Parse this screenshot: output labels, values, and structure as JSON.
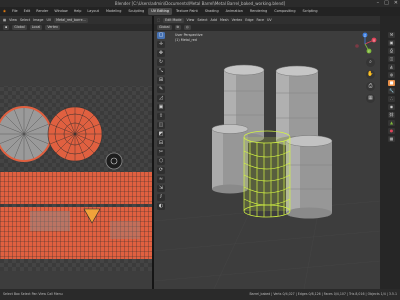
{
  "window": {
    "title": "Blender [C:\\Users\\admin\\Documents\\Metal Barrel\\Metal Barrel_baked_working.blend]"
  },
  "menubar": {
    "items": [
      "File",
      "Edit",
      "Render",
      "Window",
      "Help"
    ],
    "workspaces": [
      "Layout",
      "Modeling",
      "Sculpting",
      "UV Editing",
      "Texture Paint",
      "Shading",
      "Animation",
      "Rendering",
      "Compositing",
      "Scripting"
    ],
    "active_workspace": "UV Editing"
  },
  "uv_editor": {
    "header_items": [
      "View",
      "Select",
      "Image",
      "UV"
    ],
    "image_name": "Metal_red_barre...",
    "header2_items": [
      "Global",
      "Local"
    ],
    "snap": "Vertex"
  },
  "viewport": {
    "header_items": [
      "Edit Mode",
      "View",
      "Select",
      "Add",
      "Mesh",
      "Vertex",
      "Edge",
      "Face",
      "UV"
    ],
    "header2_items": [
      "Global"
    ],
    "view_label": "User Perspective",
    "object_label": "(1) Metal_red",
    "gizmo_axes": [
      "X",
      "Y",
      "Z"
    ]
  },
  "toolbar": {
    "icons": [
      "select-box-icon",
      "cursor-icon",
      "move-icon",
      "rotate-icon",
      "scale-icon",
      "transform-icon",
      "annotate-icon",
      "measure-icon",
      "add-cube-icon",
      "extrude-icon",
      "inset-icon",
      "bevel-icon",
      "loopcut-icon",
      "knife-icon",
      "polybuild-icon",
      "spin-icon",
      "smooth-icon",
      "shrink-icon",
      "shear-icon",
      "rip-icon"
    ],
    "glyphs": [
      "▢",
      "✛",
      "✥",
      "↻",
      "⤡",
      "⊞",
      "✎",
      "◿",
      "▣",
      "⇧",
      "◫",
      "◩",
      "⊟",
      "✂",
      "⬡",
      "⟳",
      "≈",
      "⇲",
      "⫽",
      "◐"
    ]
  },
  "statusbar": {
    "left": "Select    Box Select    Pan View    Call Menu",
    "right": "Barrel_baked | Verts 0/4,027 | Edges 0/8,126 | Faces 0/4,107 | Tris 8,016 | Objects 1/4 | 3.5.1"
  },
  "colors": {
    "selection": "#d4f542",
    "uv_fill": "#e06040",
    "mesh_gray": "#9a9a9a"
  }
}
